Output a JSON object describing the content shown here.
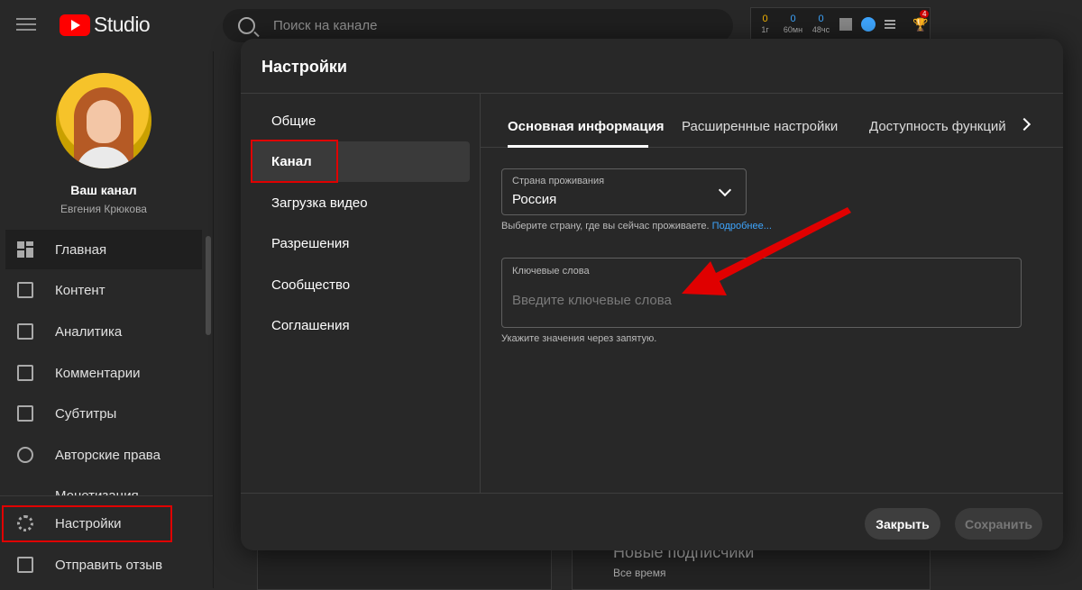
{
  "topbar": {
    "logo_text": "Studio",
    "search_placeholder": "Поиск на канале",
    "stats": [
      {
        "value": "0",
        "label": "1г",
        "color": "#f4b400"
      },
      {
        "value": "0",
        "label": "60мн",
        "color": "#3ea6ff"
      },
      {
        "value": "0",
        "label": "48чс",
        "color": "#3ea6ff"
      }
    ],
    "notif_count": "4"
  },
  "sidebar": {
    "channel_title": "Ваш канал",
    "channel_owner": "Евгения Крюкова",
    "items": [
      {
        "label": "Главная",
        "icon": "dashboard-icon"
      },
      {
        "label": "Контент",
        "icon": "content-icon"
      },
      {
        "label": "Аналитика",
        "icon": "analytics-icon"
      },
      {
        "label": "Комментарии",
        "icon": "comments-icon"
      },
      {
        "label": "Субтитры",
        "icon": "subtitles-icon"
      },
      {
        "label": "Авторские права",
        "icon": "copyright-icon"
      },
      {
        "label": "Монетизация",
        "icon": "money-icon"
      },
      {
        "label": "Настройки",
        "icon": "gear-icon"
      },
      {
        "label": "Отправить отзыв",
        "icon": "feedback-icon"
      }
    ]
  },
  "background": {
    "card_title": "Новые подписчики",
    "card_sub": "Все время"
  },
  "dialog": {
    "title": "Настройки",
    "nav": [
      "Общие",
      "Канал",
      "Загрузка видео",
      "Разрешения",
      "Сообщество",
      "Соглашения"
    ],
    "tabs": [
      "Основная информация",
      "Расширенные настройки",
      "Доступность функций"
    ],
    "country": {
      "label": "Страна проживания",
      "value": "Россия",
      "help": "Выберите страну, где вы сейчас проживаете.",
      "help_link": "Подробнее..."
    },
    "keywords": {
      "label": "Ключевые слова",
      "placeholder": "Введите ключевые слова",
      "help": "Укажите значения через запятую."
    },
    "buttons": {
      "close": "Закрыть",
      "save": "Сохранить"
    }
  },
  "colors": {
    "highlight": "#e00000",
    "arrow": "#e00000",
    "link": "#3ea6ff"
  }
}
